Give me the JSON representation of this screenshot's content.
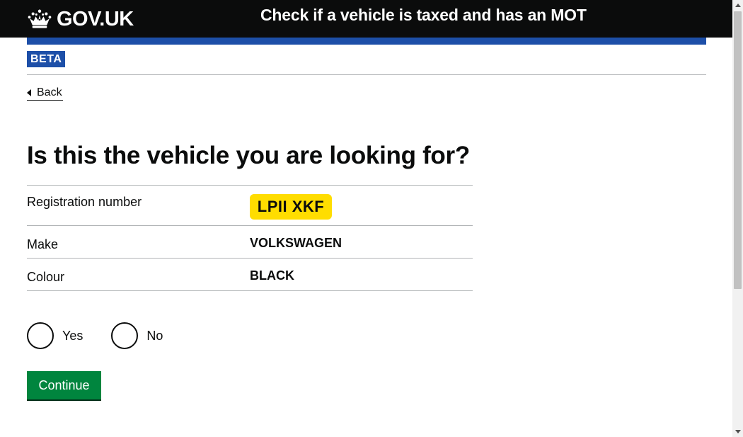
{
  "header": {
    "logo_text": "GOV.UK",
    "logo_icon": "crown-icon",
    "service_name": "Check if a vehicle is taxed and has an MOT"
  },
  "phase": {
    "tag": "BETA"
  },
  "back_link": {
    "label": "Back",
    "icon": "back-arrow-icon"
  },
  "page_title": "Is this the vehicle you are looking for?",
  "summary": {
    "rows": [
      {
        "key": "Registration number",
        "value": "LPII XKF"
      },
      {
        "key": "Make",
        "value": "VOLKSWAGEN"
      },
      {
        "key": "Colour",
        "value": "BLACK"
      }
    ]
  },
  "radios": {
    "options": [
      {
        "label": "Yes",
        "selected": false
      },
      {
        "label": "No",
        "selected": false
      }
    ]
  },
  "continue_label": "Continue",
  "colors": {
    "header_bg": "#0b0c0c",
    "brand_blue": "#1d4fa8",
    "plate_yellow": "#ffdd00",
    "button_green": "#00853e",
    "border_grey": "#b1b4b6"
  }
}
